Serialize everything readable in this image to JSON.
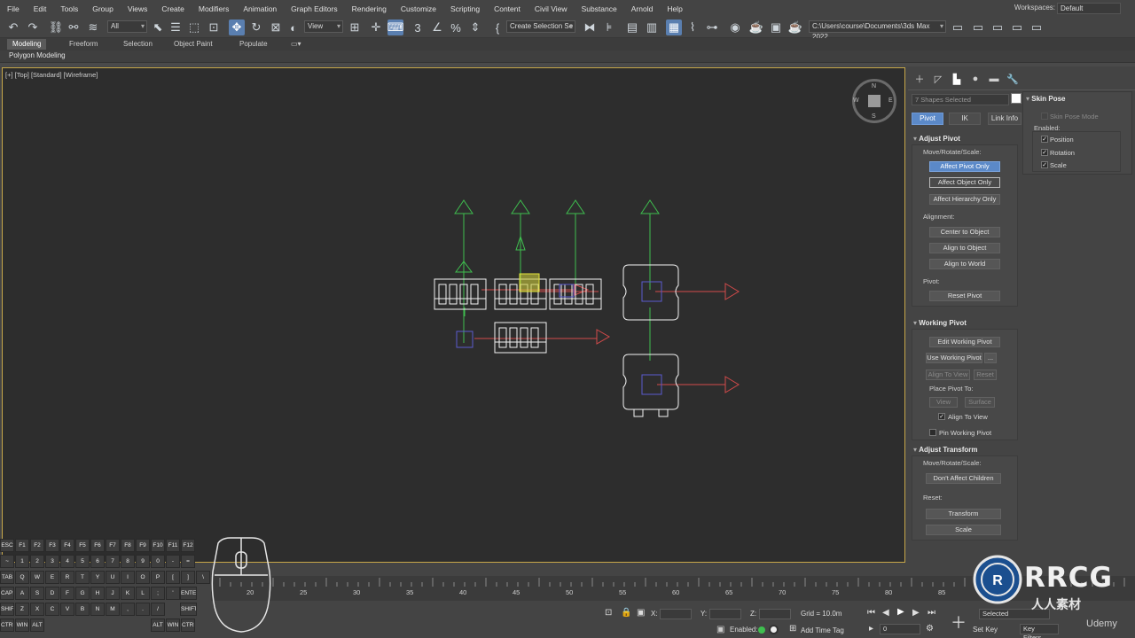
{
  "menu": [
    "File",
    "Edit",
    "Tools",
    "Group",
    "Views",
    "Create",
    "Modifiers",
    "Animation",
    "Graph Editors",
    "Rendering",
    "Customize",
    "Scripting",
    "Content",
    "Civil View",
    "Substance",
    "Arnold",
    "Help"
  ],
  "workspace": {
    "label": "Workspaces:",
    "value": "Default"
  },
  "toolbar": {
    "selection_filter": "All",
    "ref_coord": "View",
    "create_selection_set": "Create Selection Se",
    "project_path": "C:\\Users\\course\\Documents\\3ds Max 2022"
  },
  "ribbon": {
    "tabs": [
      "Modeling",
      "Freeform",
      "Selection",
      "Object Paint",
      "Populate"
    ],
    "active_tab": "Modeling",
    "sub_label": "Polygon Modeling"
  },
  "viewport": {
    "label": "[+] [Top] [Standard] [Wireframe]",
    "viewcube": {
      "top": "N",
      "left": "W",
      "right": "E",
      "bottom": "S"
    }
  },
  "command_panel": {
    "selection_text": "7 Shapes Selected",
    "hierarchy_tabs": [
      "Pivot",
      "IK",
      "Link Info"
    ],
    "active_tab": "Pivot",
    "adjust_pivot": {
      "title": "Adjust Pivot",
      "move_label": "Move/Rotate/Scale:",
      "buttons": [
        "Affect Pivot Only",
        "Affect Object Only",
        "Affect Hierarchy Only"
      ],
      "alignment_label": "Alignment:",
      "align_buttons": [
        "Center to Object",
        "Align to Object",
        "Align to World"
      ],
      "pivot_label": "Pivot:",
      "reset_pivot": "Reset Pivot"
    },
    "working_pivot": {
      "title": "Working Pivot",
      "edit": "Edit Working Pivot",
      "use": "Use Working Pivot",
      "use_more": "...",
      "align_to_view": "Align To View",
      "reset": "Reset",
      "place_label": "Place Pivot To:",
      "view": "View",
      "surface": "Surface",
      "align_to_view_chk": "Align To View",
      "pin": "Pin Working Pivot"
    },
    "adjust_transform": {
      "title": "Adjust Transform",
      "move_label": "Move/Rotate/Scale:",
      "dont_affect": "Don't Affect Children",
      "reset_label": "Reset:",
      "transform": "Transform",
      "scale": "Scale"
    },
    "skin_pose": {
      "title": "Skin Pose",
      "mode": "Skin Pose Mode",
      "enabled_label": "Enabled:",
      "items": [
        "Position",
        "Rotation",
        "Scale"
      ]
    }
  },
  "keyboard": {
    "rows": [
      [
        "ESC",
        "F1",
        "F2",
        "F3",
        "F4",
        "F5",
        "F6",
        "F7",
        "F8",
        "F9",
        "F10",
        "F11",
        "F12"
      ],
      [
        "~",
        "1",
        "2",
        "3",
        "4",
        "5",
        "6",
        "7",
        "8",
        "9",
        "0",
        "-",
        "="
      ],
      [
        "TAB",
        "Q",
        "W",
        "E",
        "R",
        "T",
        "Y",
        "U",
        "I",
        "O",
        "P",
        "[",
        "]",
        "\\"
      ],
      [
        "CAPS",
        "A",
        "S",
        "D",
        "F",
        "G",
        "H",
        "J",
        "K",
        "L",
        ";",
        "'"
      ],
      [
        "SHIFT",
        "Z",
        "X",
        "C",
        "V",
        "B",
        "N",
        "M",
        ",",
        ".",
        "/"
      ],
      [
        "CTRL",
        "WIN",
        "ALT"
      ]
    ],
    "enter": "ENTER",
    "shift_r": "SHIFT",
    "bottom_right": [
      "ALT",
      "WIN",
      "CTRL"
    ]
  },
  "timeline": {
    "ticks": [
      "20",
      "25",
      "30",
      "35",
      "40",
      "45",
      "50",
      "55",
      "60",
      "65",
      "70",
      "75",
      "80",
      "85"
    ]
  },
  "status": {
    "x_label": "X:",
    "y_label": "Y:",
    "z_label": "Z:",
    "grid": "Grid = 10.0m",
    "enabled": "Enabled:",
    "add_time_tag": "Add Time Tag",
    "frame": "0",
    "selected": "Selected",
    "set_key": "Set Key",
    "key_filters": "Key Filters..."
  },
  "watermark": {
    "brand": "RRCG",
    "chinese": "人人素材",
    "udemy": "Udemy"
  }
}
